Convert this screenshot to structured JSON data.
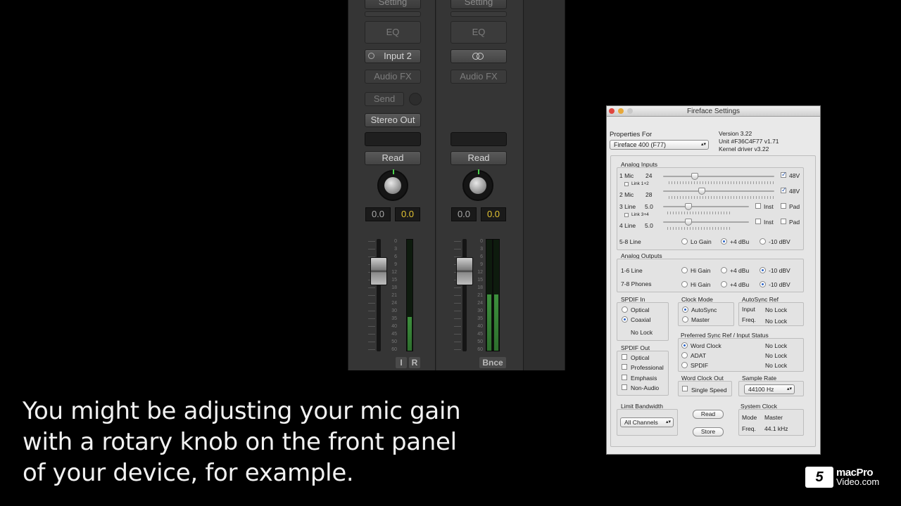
{
  "mixer": {
    "strips": [
      {
        "setting": "Setting",
        "eq": "EQ",
        "input": "Input 2",
        "audio_fx": "Audio FX",
        "send": "Send",
        "output": "Stereo Out",
        "automation": "Read",
        "value_left": "0.0",
        "value_right": "0.0",
        "btn_i": "I",
        "btn_r": "R"
      },
      {
        "setting": "Setting",
        "eq": "EQ",
        "input_icon": "stereo-link-icon",
        "audio_fx": "Audio FX",
        "automation": "Read",
        "value_left": "0.0",
        "value_right": "0.0",
        "bounce": "Bnce"
      }
    ],
    "meter_scale": [
      "0",
      "3",
      "6",
      "9",
      "12",
      "15",
      "18",
      "21",
      "24",
      "30",
      "35",
      "40",
      "45",
      "50",
      "60"
    ]
  },
  "fireface": {
    "title": "Fireface Settings",
    "properties_for": "Properties For",
    "device": "Fireface 400 (F77)",
    "version": "Version 3.22",
    "unit": "Unit #F36C4F77  v1.71",
    "kernel": "Kernel driver v3.22",
    "analog_inputs": {
      "label": "Analog Inputs",
      "rows": [
        {
          "name": "1 Mic",
          "value": "24",
          "opt1": "48V",
          "gain": 24
        },
        {
          "name": "2 Mic",
          "value": "28",
          "opt1": "48V",
          "gain": 28
        },
        {
          "name": "3 Line",
          "value": "5.0",
          "opt1": "Inst",
          "opt2": "Pad",
          "gain": 5.0
        },
        {
          "name": "4 Line",
          "value": "5.0",
          "opt1": "Inst",
          "opt2": "Pad",
          "gain": 5.0
        }
      ],
      "link12": "Link 1+2",
      "link34": "Link 3+4",
      "line58": "5-8 Line",
      "line58_opts": [
        "Lo Gain",
        "+4 dBu",
        "-10 dBV"
      ]
    },
    "analog_outputs": {
      "label": "Analog Outputs",
      "row1": "1-6 Line",
      "row2": "7-8 Phones",
      "opts": [
        "Hi Gain",
        "+4 dBu",
        "-10 dBV"
      ]
    },
    "spdif_in": {
      "label": "SPDIF In",
      "opts": [
        "Optical",
        "Coaxial"
      ],
      "status": "No Lock"
    },
    "clock_mode": {
      "label": "Clock Mode",
      "opts": [
        "AutoSync",
        "Master"
      ]
    },
    "autosync_ref": {
      "label": "AutoSync Ref",
      "input": "Input",
      "input_val": "No Lock",
      "freq": "Freq.",
      "freq_val": "No Lock"
    },
    "pref_sync": {
      "label": "Preferred Sync Ref / Input Status",
      "rows": [
        {
          "name": "Word Clock",
          "status": "No Lock"
        },
        {
          "name": "ADAT",
          "status": "No Lock"
        },
        {
          "name": "SPDIF",
          "status": "No Lock"
        }
      ]
    },
    "spdif_out": {
      "label": "SPDIF Out",
      "opts": [
        "Optical",
        "Professional",
        "Emphasis",
        "Non-Audio"
      ]
    },
    "word_clock_out": {
      "label": "Word Clock Out",
      "single_speed": "Single Speed"
    },
    "sample_rate": {
      "label": "Sample Rate",
      "value": "44100 Hz"
    },
    "limit_bandwidth": {
      "label": "Limit Bandwidth",
      "value": "All Channels"
    },
    "read_btn": "Read",
    "store_btn": "Store",
    "system_clock": {
      "label": "System Clock",
      "mode": "Mode",
      "mode_val": "Master",
      "freq": "Freq.",
      "freq_val": "44.1 kHz"
    }
  },
  "caption": {
    "line1": "You might be adjusting your mic gain",
    "line2": "with a rotary knob on the front panel",
    "line3": "of your device, for example."
  },
  "logo": {
    "line1": "macPro",
    "line2": "Video.com"
  }
}
